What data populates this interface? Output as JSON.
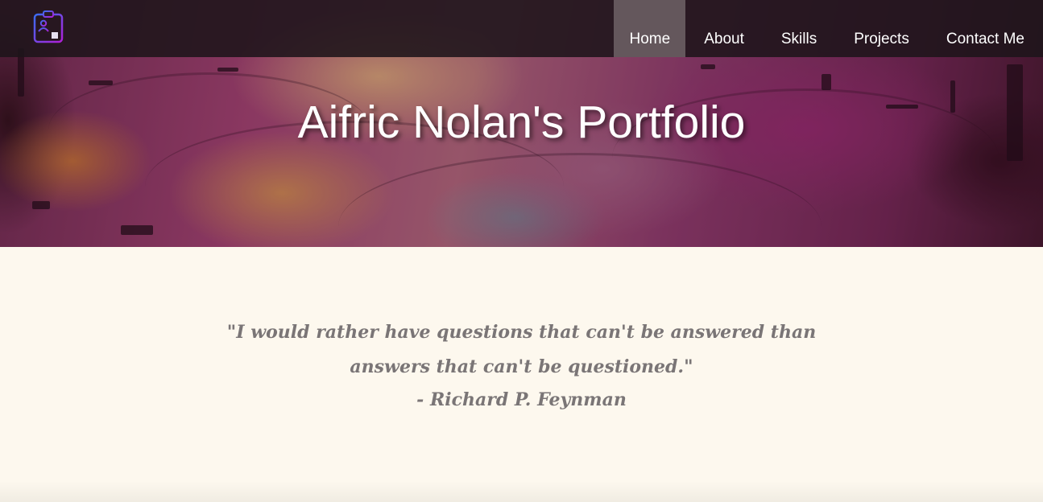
{
  "nav": {
    "logo_icon": "id-badge-icon",
    "items": [
      {
        "label": "Home",
        "active": true
      },
      {
        "label": "About",
        "active": false
      },
      {
        "label": "Skills",
        "active": false
      },
      {
        "label": "Projects",
        "active": false
      },
      {
        "label": "Contact Me",
        "active": false
      }
    ]
  },
  "hero": {
    "title": "Aifric Nolan's Portfolio"
  },
  "quote": {
    "text": "\"I would rather have questions that can't be answered than answers that can't be questioned.\"",
    "author": "- Richard P. Feynman"
  },
  "colors": {
    "nav_bg": "#1e141a",
    "nav_active_bg": "#786c70",
    "quote_bg": "#fdf8ee",
    "quote_text": "#7a7576",
    "logo_accent": "#8a2be2"
  }
}
